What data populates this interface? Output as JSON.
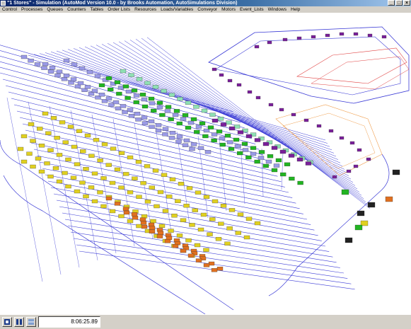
{
  "window": {
    "title": "\"1 Stores\" - Simulation (AutoMod Version 10.0 - by Brooks Automation, AutoSimulations Division)",
    "controls": {
      "minimize": "_",
      "maximize": "□",
      "close": "×"
    }
  },
  "menu": [
    "Control",
    "Processes",
    "Queues",
    "Counters",
    "Tables",
    "Order Lists",
    "Resources",
    "Loads/Variables",
    "Conveyor",
    "Motors",
    "Event_Lists",
    "Windows",
    "Help"
  ],
  "status": {
    "clock": "8:06:25.89"
  },
  "icons": {
    "app": "automod-app-icon",
    "run": "run-icon",
    "step": "step-icon",
    "view": "view-icon"
  },
  "colors": {
    "track": "#3b3bd6",
    "lavender": "#9a9ae6",
    "yellow": "#e0d020",
    "green": "#22b422",
    "teal": "#8fe0b4",
    "purple": "#7a1f9a",
    "orange": "#e07020",
    "conveyor_red": "#e04040",
    "outline_orange": "#f0a050"
  }
}
